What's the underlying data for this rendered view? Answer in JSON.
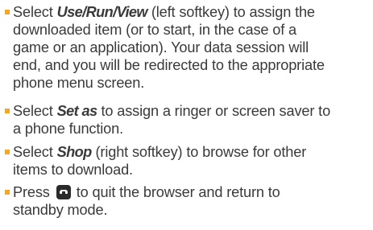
{
  "bullet_color": "#f5a623",
  "text_color": "#3a3a3a",
  "bullets": [
    {
      "prefix": "Select ",
      "emphasis": "Use/Run/View",
      "line1_rest": " (left softkey) to assign the",
      "line2": "downloaded item (or to start, in the case of a",
      "line3": "game or an application). Your data session will",
      "line4": "end, and you will be redirected to the appropriate",
      "line5": "phone menu screen."
    },
    {
      "prefix": "Select ",
      "emphasis": "Set as",
      "line1_rest": " to assign a ringer or screen saver to",
      "line2": "a phone function."
    },
    {
      "prefix": "Select ",
      "emphasis": "Shop",
      "line1_rest": " (right softkey) to browse for other",
      "line2": "items to download."
    },
    {
      "prefix": "Press",
      "icon": "end-key-icon",
      "line1_rest": "to quit the browser and return to",
      "line2": "standby mode."
    }
  ]
}
